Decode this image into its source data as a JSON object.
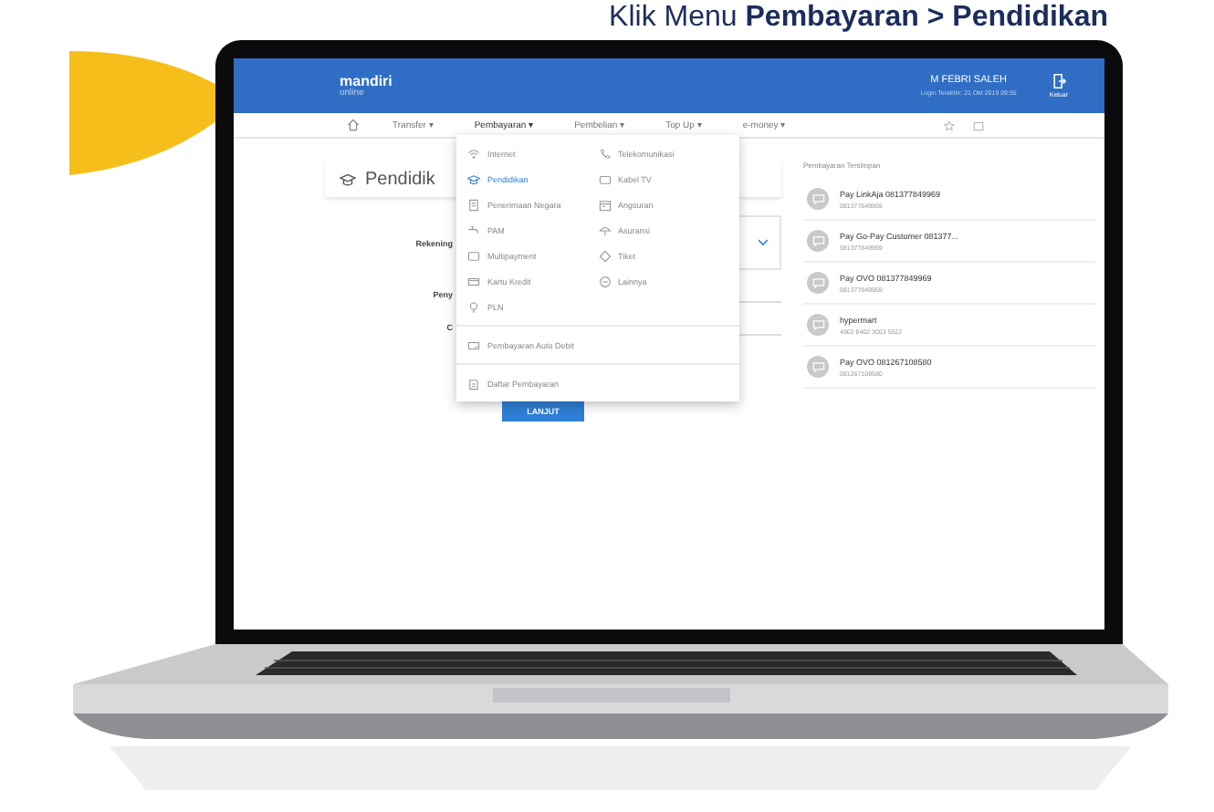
{
  "heading": "Klik Menu **Pembayaran > Pendidikan**",
  "header": {
    "logo": "mandiri",
    "logo_sub": "online",
    "user": "M FEBRI SALEH",
    "last_login": "Login Terakhir: 21 Okt 2019 09:55",
    "logout": "Keluar"
  },
  "nav": [
    {
      "label": "Transfer ▾",
      "selected": false
    },
    {
      "label": "Pembayaran ▾",
      "selected": true
    },
    {
      "label": "Pembelian ▾",
      "selected": false
    },
    {
      "label": "Top Up ▾",
      "selected": false
    },
    {
      "label": "e-money ▾",
      "selected": false
    }
  ],
  "menu": {
    "columns": [
      [
        {
          "label": "Internet",
          "selected": false
        },
        {
          "label": "Pendidikan",
          "selected": true
        },
        {
          "label": "Penerimaan Negara",
          "selected": false
        },
        {
          "label": "PAM",
          "selected": false
        },
        {
          "label": "Multipayment",
          "selected": false
        },
        {
          "label": "Kartu Kredit",
          "selected": false
        },
        {
          "label": "PLN",
          "selected": false
        }
      ],
      [
        {
          "label": "Telekomunikasi",
          "selected": false
        },
        {
          "label": "Kabel TV",
          "selected": false
        },
        {
          "label": "Angsuran",
          "selected": false
        },
        {
          "label": "Asuransi",
          "selected": false
        },
        {
          "label": "Tiket",
          "selected": false
        },
        {
          "label": "Lainnya",
          "selected": false
        }
      ]
    ],
    "extra": [
      {
        "label": "Pembayaran Auto Debit",
        "selected": false
      },
      {
        "label": "Daftar Pembayaran",
        "selected": false
      }
    ]
  },
  "page": {
    "title": "Pendidik",
    "fields": [
      {
        "label": "Rekening"
      },
      {
        "label": "Peny"
      },
      {
        "label": "C"
      }
    ],
    "button": "LANJUT"
  },
  "saved": {
    "title": "Pembayaran Tersimpan",
    "items": [
      {
        "name": "Pay LinkAja 081377849969",
        "number": "081377849969"
      },
      {
        "name": "Pay Go-Pay Customer 081377...",
        "number": "081377849969"
      },
      {
        "name": "Pay OVO 081377849969",
        "number": "081377849969"
      },
      {
        "name": "hypermart",
        "number": "4902 8402 3003 5522"
      },
      {
        "name": "Pay OVO 081267108580",
        "number": "081267108580"
      }
    ]
  }
}
